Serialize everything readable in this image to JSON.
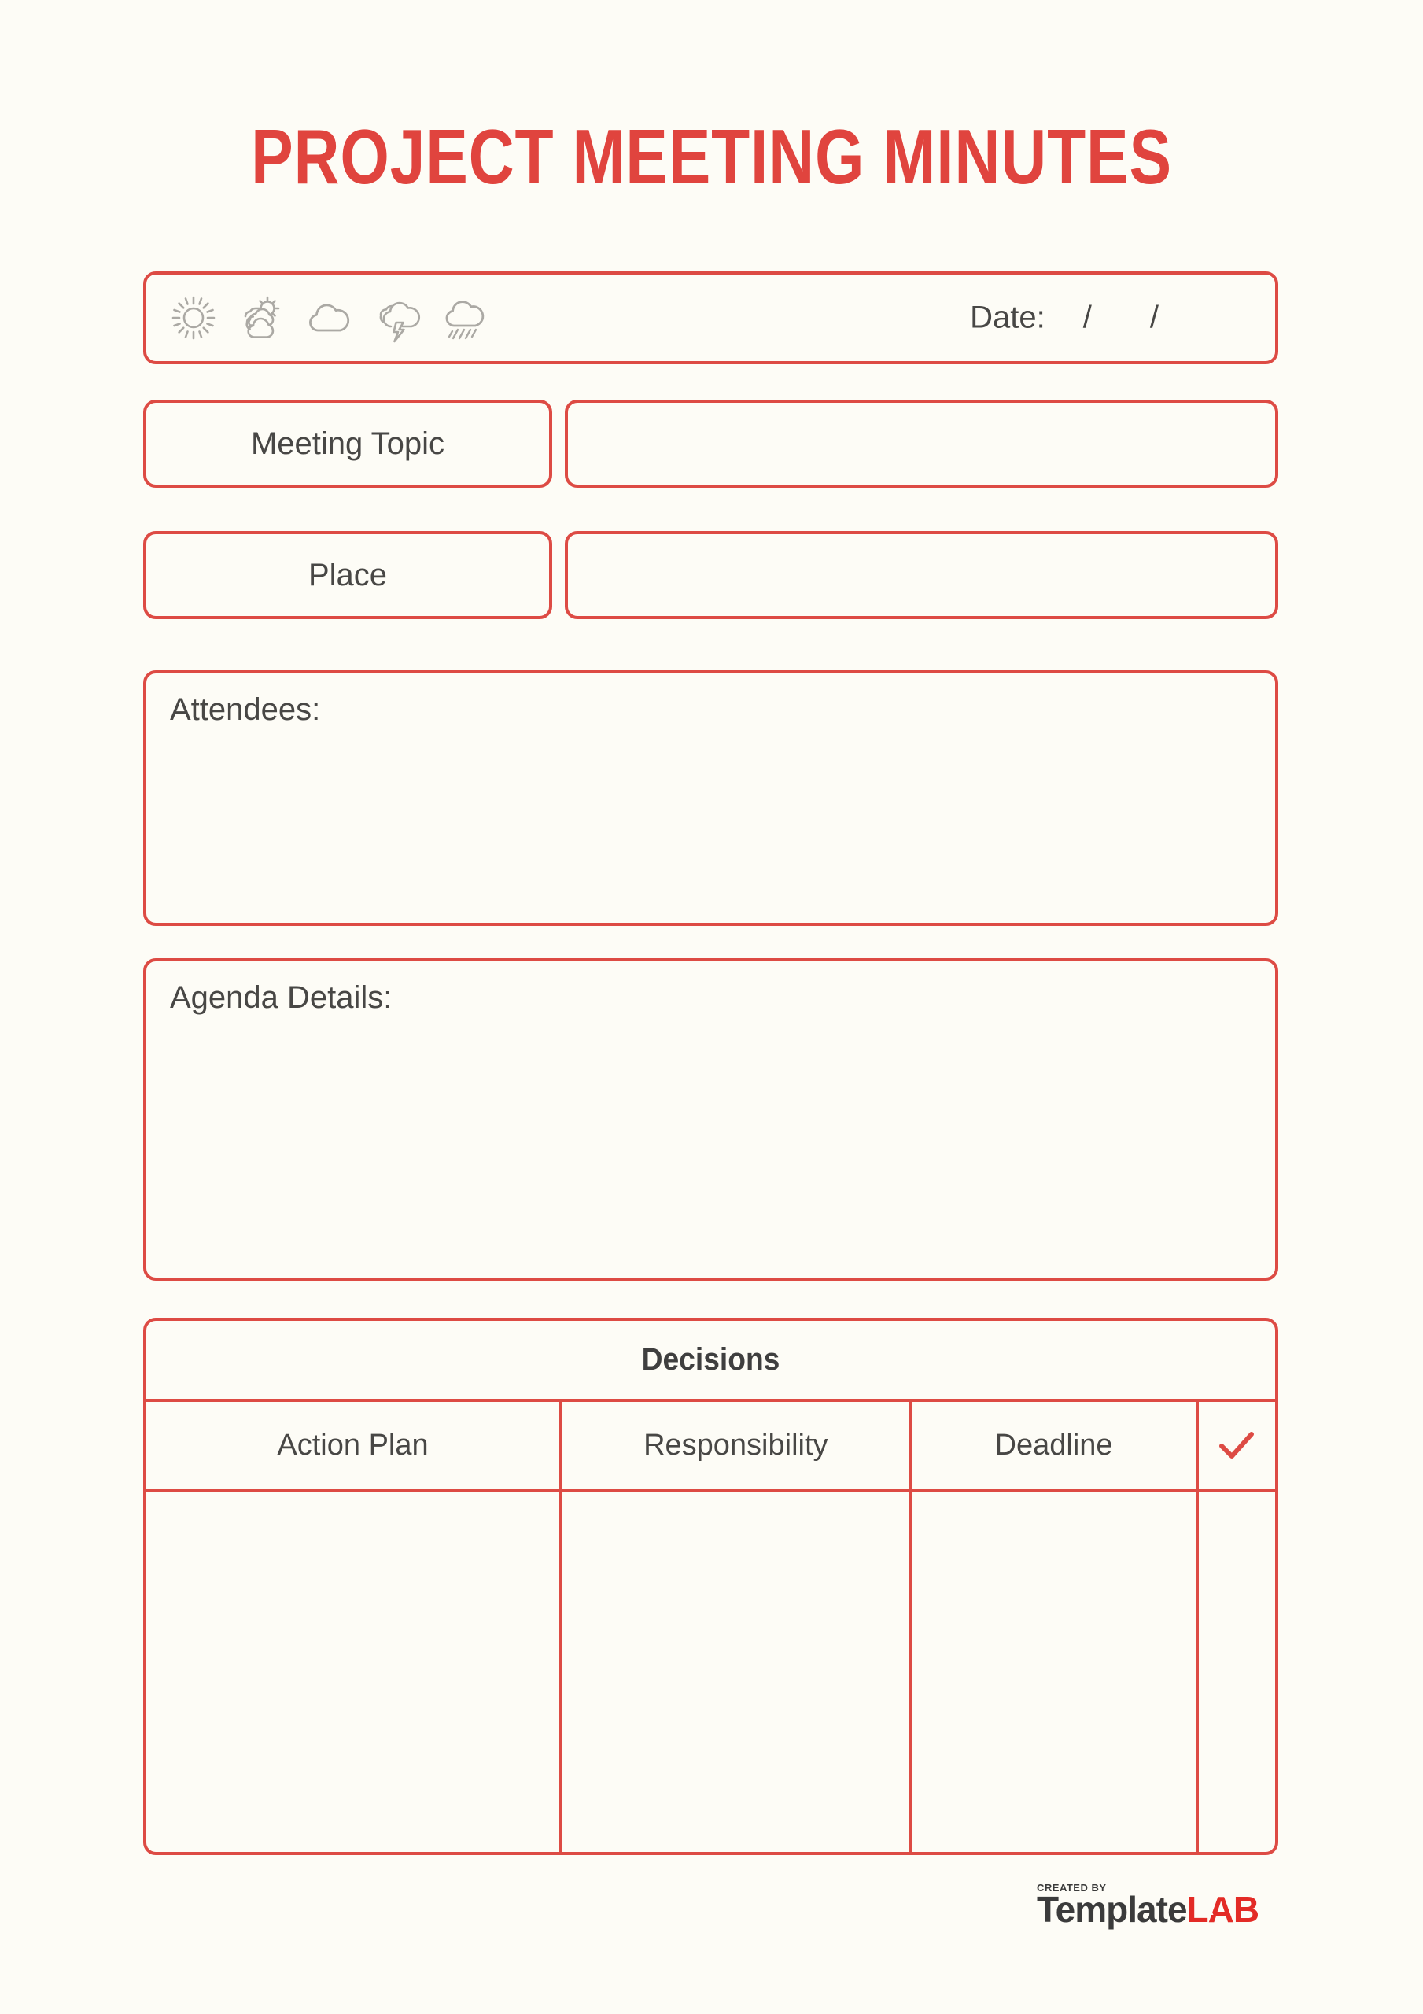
{
  "document": {
    "title": "PROJECT MEETING MINUTES",
    "accent_color": "#dd4b44",
    "title_color": "#e0443e",
    "text_color": "#484745",
    "background_color": "#fdfcf6",
    "icon_color": "#aba9a4"
  },
  "header_bar": {
    "weather_icons": [
      {
        "name": "sun-icon",
        "label": "Sunny"
      },
      {
        "name": "partly-cloudy-icon",
        "label": "Partly Cloudy"
      },
      {
        "name": "cloud-icon",
        "label": "Cloudy"
      },
      {
        "name": "thunderstorm-icon",
        "label": "Thunderstorm"
      },
      {
        "name": "rain-icon",
        "label": "Rain"
      }
    ],
    "date_label": "Date:",
    "date_separator_1": "/",
    "date_separator_2": "/",
    "date_value": ""
  },
  "fields": {
    "meeting_topic_label": "Meeting Topic",
    "meeting_topic_value": "",
    "place_label": "Place",
    "place_value": ""
  },
  "sections": {
    "attendees_label": "Attendees:",
    "attendees_value": "",
    "agenda_label": "Agenda Details:",
    "agenda_value": ""
  },
  "decisions": {
    "title": "Decisions",
    "columns": [
      "Action Plan",
      "Responsibility",
      "Deadline",
      "✓"
    ],
    "rows": [
      {
        "action_plan": "",
        "responsibility": "",
        "deadline": "",
        "done": ""
      }
    ]
  },
  "footer": {
    "created_by": "CREATED BY",
    "brand_first": "Template",
    "brand_second": "LAB"
  }
}
